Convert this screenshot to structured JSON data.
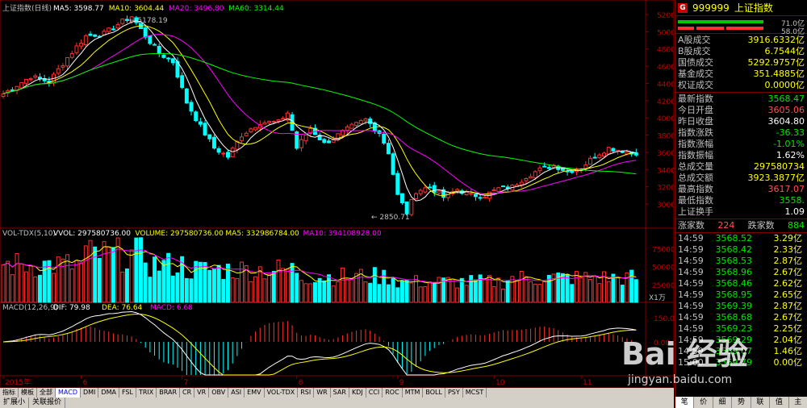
{
  "main": {
    "title": "上证指数(日线)",
    "ma": [
      {
        "label": "MA5: 3598.77",
        "color": "#ffffff"
      },
      {
        "label": "MA10: 3604.44",
        "color": "#ffff00"
      },
      {
        "label": "MA20: 3496.80",
        "color": "#ff00ff"
      },
      {
        "label": "MA60: 3314.44",
        "color": "#00ff00"
      }
    ],
    "high_label": "5178.19",
    "low_label": "2850.71",
    "y_ticks": [
      "5200",
      "5000",
      "4800",
      "4600",
      "4400",
      "4200",
      "4000",
      "3800",
      "3600",
      "3400",
      "3200",
      "3000"
    ],
    "y_values": [
      5200,
      5000,
      4800,
      4600,
      4400,
      4200,
      4000,
      3800,
      3600,
      3400,
      3200,
      3000
    ]
  },
  "vol": {
    "title": "VOL-TDX(5,10)",
    "items": [
      {
        "label": "VVOL: 297580736.00",
        "color": "#ffffff"
      },
      {
        "label": "VOLUME: 297580736.00",
        "color": "#ffff00"
      },
      {
        "label": "MA5: 332986784.00",
        "color": "#ffff00"
      },
      {
        "label": "MA10: 394108928.00",
        "color": "#ff00ff"
      }
    ],
    "y_ticks": [
      "75000",
      "50000",
      "25000"
    ],
    "unit": "X1万"
  },
  "macd": {
    "title": "MACD(12,26,9)",
    "items": [
      {
        "label": "DIF: 79.98",
        "color": "#ffffff"
      },
      {
        "label": "DEA: 76.64",
        "color": "#ffff00"
      },
      {
        "label": "MACD: 6.68",
        "color": "#ff00ff"
      }
    ],
    "y_ticks": [
      "150.0",
      "0.00"
    ]
  },
  "x_labels": [
    {
      "text": "2015年",
      "i": 0
    },
    {
      "text": "6",
      "i": 17
    },
    {
      "text": "7",
      "i": 39
    },
    {
      "text": "8",
      "i": 64
    },
    {
      "text": "9",
      "i": 86
    },
    {
      "text": "10",
      "i": 107
    },
    {
      "text": "11",
      "i": 126
    }
  ],
  "bottom_tabs": [
    "指标",
    "模板",
    "全部",
    "MACD",
    "DMI",
    "DMA",
    "FSL",
    "TRIX",
    "BRAR",
    "CR",
    "VR",
    "OBV",
    "ASI",
    "EMV",
    "VOL-TDX",
    "RSI",
    "WR",
    "SAR",
    "KDJ",
    "CCI",
    "ROC",
    "MTM",
    "BOLL",
    "PSY",
    "MCST"
  ],
  "bottom_tabs2": [
    "扩展小",
    "关联报价"
  ],
  "right": {
    "code": "999999",
    "name": "上证指数",
    "bar_up": "71.0亿",
    "bar_down": "58.0亿",
    "turnover": [
      {
        "label": "A股成交",
        "value": "3916.6332亿"
      },
      {
        "label": "B股成交",
        "value": "6.7544亿"
      },
      {
        "label": "国债成交",
        "value": "5292.9757亿"
      },
      {
        "label": "基金成交",
        "value": "351.4885亿"
      },
      {
        "label": "权证成交",
        "value": "0.0000亿"
      }
    ],
    "quote": [
      {
        "label": "最新指数",
        "value": "3568.47",
        "color": "#00e600"
      },
      {
        "label": "今日开盘",
        "value": "3605.06",
        "color": "#ff5050"
      },
      {
        "label": "昨日收盘",
        "value": "3604.80",
        "color": "#ffffff"
      },
      {
        "label": "指数涨跌",
        "value": "-36.33",
        "color": "#00e600"
      },
      {
        "label": "指数涨幅",
        "value": "-1.01%",
        "color": "#00e600"
      },
      {
        "label": "指数振幅",
        "value": "1.62%",
        "color": "#ffffff"
      },
      {
        "label": "总成交量",
        "value": "297580734",
        "color": "#ffff00"
      },
      {
        "label": "总成交额",
        "value": "3923.3877亿",
        "color": "#ffff00"
      },
      {
        "label": "最高指数",
        "value": "3617.07",
        "color": "#ff5050"
      },
      {
        "label": "最低指数",
        "value": "3558.",
        "color": "#00e600"
      },
      {
        "label": "上证换手",
        "value": "1.09",
        "color": "#ffffff"
      }
    ],
    "updown": {
      "up_label": "涨家数",
      "up": "224",
      "down_label": "跌家数",
      "down": "884"
    },
    "ticks": [
      {
        "t": "14:59",
        "p": "3568.52",
        "v": "3.29亿"
      },
      {
        "t": "14:59",
        "p": "3568.42",
        "v": "2.33亿"
      },
      {
        "t": "14:59",
        "p": "3568.53",
        "v": "2.87亿"
      },
      {
        "t": "14:59",
        "p": "3568.96",
        "v": "2.67亿"
      },
      {
        "t": "14:59",
        "p": "3568.46",
        "v": "2.62亿"
      },
      {
        "t": "14:59",
        "p": "3568.95",
        "v": "2.65亿"
      },
      {
        "t": "14:59",
        "p": "3569.39",
        "v": "2.87亿"
      },
      {
        "t": "14:59",
        "p": "3568.68",
        "v": "2.67亿"
      },
      {
        "t": "14:59",
        "p": "3569.23",
        "v": "2.25亿"
      },
      {
        "t": "14:59",
        "p": "3569.29",
        "v": "2.04亿"
      },
      {
        "t": "14:59",
        "p": "3569.07",
        "v": "1.46亿"
      },
      {
        "t": "15:00",
        "p": "3569.79",
        "v": "0.00亿"
      }
    ],
    "tabs": [
      "笔",
      "价",
      "细",
      "势",
      "联",
      "值",
      "主"
    ]
  },
  "watermark": {
    "line1": "Bai 经验",
    "line2": "jingyan.baidu.com"
  }
}
